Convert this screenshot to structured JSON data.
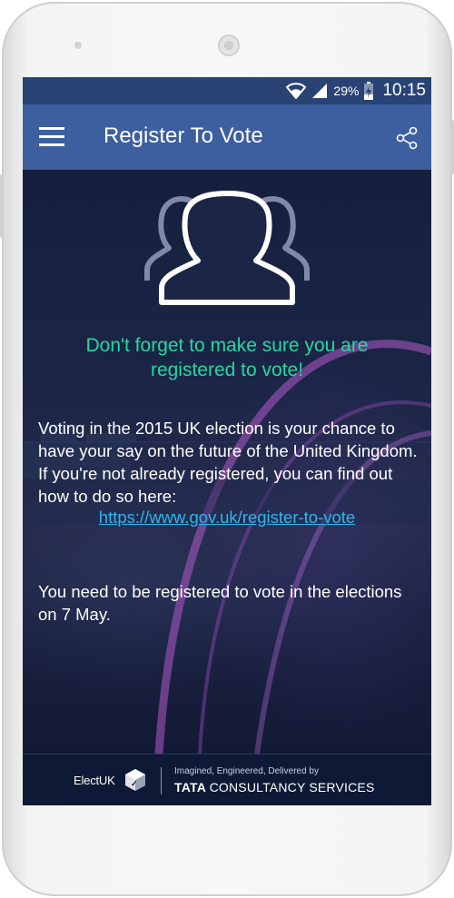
{
  "status_bar": {
    "battery_percent": "29%",
    "time": "10:15",
    "icons": [
      "wifi-icon",
      "signal-icon",
      "battery-charging-icon"
    ]
  },
  "app_bar": {
    "title": "Register To Vote",
    "icons": [
      "menu-icon",
      "share-icon"
    ],
    "color": "#3d5f9f"
  },
  "content": {
    "icon": "people-group-icon",
    "headline": "Don't forget to make sure you are registered to vote!",
    "paragraph1": "Voting in the 2015 UK election is your chance to have your say on the future of the United Kingdom. If you're not already registered, you can find out how to do so here:",
    "link_text": "https://www.gov.uk/register-to-vote",
    "paragraph2": "You need to be registered to vote in the elections on 7 May.",
    "headline_color": "#22d9a0",
    "link_color": "#2bb8f0"
  },
  "footer": {
    "app_name": "ElectUK",
    "tagline": "Imagined, Engineered, Delivered by",
    "brand_bold": "TATA",
    "brand_rest": "CONSULTANCY SERVICES"
  }
}
